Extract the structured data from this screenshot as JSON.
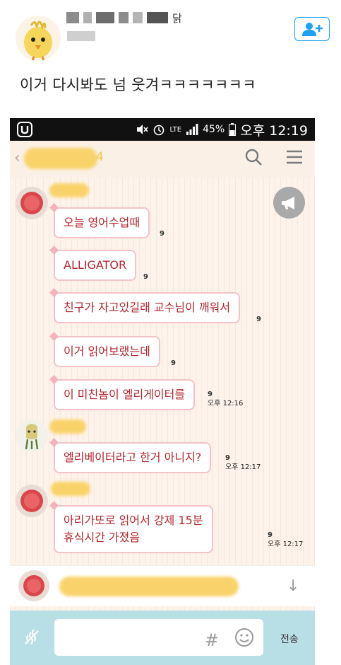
{
  "tweet": {
    "name_suffix": "닭",
    "text": "이거 다시봐도 넘 웃겨ㅋㅋㅋㅋㅋㅋㅋ"
  },
  "status_bar": {
    "network": "LTE",
    "battery": "45%",
    "time": "오후 12:19"
  },
  "chat": {
    "unread_count": "4",
    "messages": [
      {
        "text": "오늘 영어수업때",
        "count": "9",
        "time": ""
      },
      {
        "text": "ALLIGATOR",
        "count": "9",
        "time": ""
      },
      {
        "text": "친구가 자고있길래 교수님이 깨워서",
        "count": "9",
        "time": ""
      },
      {
        "text": "이거 읽어보랬는데",
        "count": "9",
        "time": ""
      },
      {
        "text": "이 미친놈이 엘리게이터를",
        "count": "9",
        "time": "오후 12:16"
      },
      {
        "text": "엘리베이터라고 한거 아니지?",
        "count": "9",
        "time": "오후 12:17"
      },
      {
        "text": "아리가또로 읽어서 강제 15분\n휴식시간 가졌음",
        "count": "9",
        "time": "오후 12:17"
      }
    ]
  },
  "input": {
    "send_label": "전송",
    "hash_symbol": "#"
  },
  "colors": {
    "accent_twitter": "#1da1f2",
    "bubble_text": "#b3262e",
    "bubble_border": "#f4c2c8",
    "input_bar": "#b9dfe6"
  }
}
